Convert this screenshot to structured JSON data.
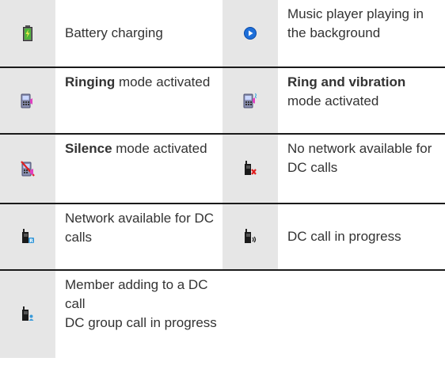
{
  "rows": [
    {
      "left": {
        "icon": "battery-charging-icon",
        "text": "Battery charging"
      },
      "right": {
        "icon": "music-player-icon",
        "text": "Music player playing in the background"
      }
    },
    {
      "left": {
        "icon": "ringing-mode-icon",
        "bold": "Ringing",
        "text": " mode activated"
      },
      "right": {
        "icon": "ring-vibration-mode-icon",
        "bold": "Ring and vibration",
        "text": " mode activated"
      }
    },
    {
      "left": {
        "icon": "silence-mode-icon",
        "bold": "Silence",
        "text": " mode activated"
      },
      "right": {
        "icon": "no-network-dc-icon",
        "text": "No network available for DC calls"
      }
    },
    {
      "left": {
        "icon": "network-dc-available-icon",
        "text": "Network available for DC calls"
      },
      "right": {
        "icon": "dc-call-in-progress-icon",
        "text": "DC call in progress"
      }
    },
    {
      "left": {
        "icon": "dc-member-add-icon",
        "text": "Member adding to a DC call",
        "text2": "DC group call in progress"
      },
      "right": null
    }
  ]
}
